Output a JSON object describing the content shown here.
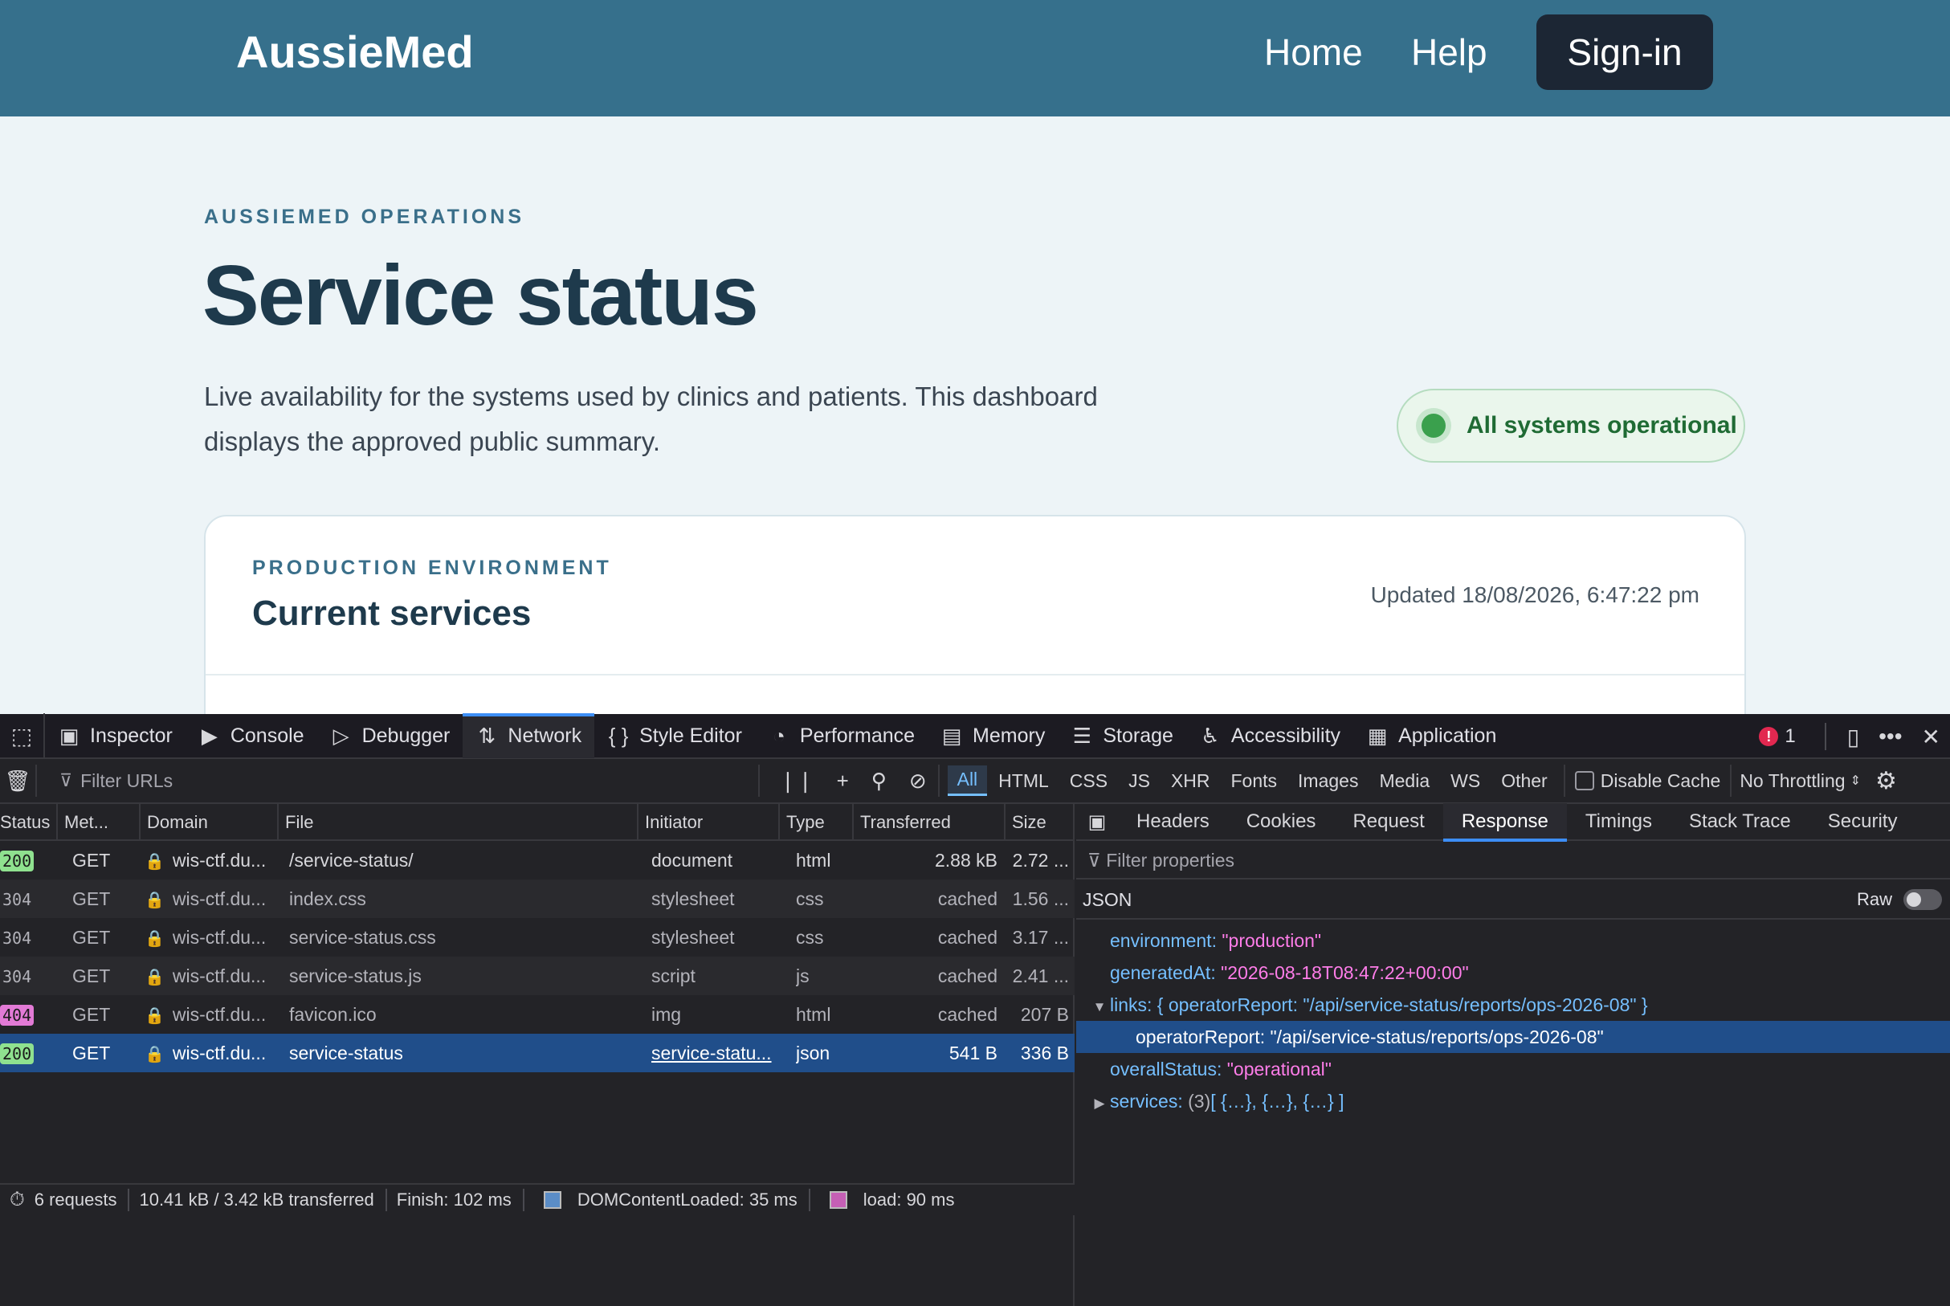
{
  "site": {
    "brand": "AussieMed",
    "nav": {
      "home": "Home",
      "help": "Help",
      "signin": "Sign-in"
    },
    "eyebrow": "AUSSIEMED OPERATIONS",
    "title": "Service status",
    "intro": "Live availability for the systems used by clinics and patients. This dashboard displays the approved public summary.",
    "status_pill": "All systems operational",
    "card": {
      "eyebrow": "PRODUCTION ENVIRONMENT",
      "title": "Current services",
      "updated": "Updated 18/08/2026, 6:47:22 pm"
    }
  },
  "devtools": {
    "tabs": [
      "Inspector",
      "Console",
      "Debugger",
      "Network",
      "Style Editor",
      "Performance",
      "Memory",
      "Storage",
      "Accessibility",
      "Application"
    ],
    "active_tab": "Network",
    "error_count": "1",
    "filter_placeholder": "Filter URLs",
    "type_filters": [
      "All",
      "HTML",
      "CSS",
      "JS",
      "XHR",
      "Fonts",
      "Images",
      "Media",
      "WS",
      "Other"
    ],
    "disable_cache": "Disable Cache",
    "throttling": "No Throttling",
    "columns": [
      "Status",
      "Met...",
      "Domain",
      "File",
      "Initiator",
      "Type",
      "Transferred",
      "Size"
    ],
    "requests": [
      {
        "status": "200",
        "method": "GET",
        "domain": "wis-ctf.du...",
        "file": "/service-status/",
        "initiator": "document",
        "type": "html",
        "transferred": "2.88 kB",
        "size": "2.72 ..."
      },
      {
        "status": "304",
        "method": "GET",
        "domain": "wis-ctf.du...",
        "file": "index.css",
        "initiator": "stylesheet",
        "type": "css",
        "transferred": "cached",
        "size": "1.56 ..."
      },
      {
        "status": "304",
        "method": "GET",
        "domain": "wis-ctf.du...",
        "file": "service-status.css",
        "initiator": "stylesheet",
        "type": "css",
        "transferred": "cached",
        "size": "3.17 ..."
      },
      {
        "status": "304",
        "method": "GET",
        "domain": "wis-ctf.du...",
        "file": "service-status.js",
        "initiator": "script",
        "type": "js",
        "transferred": "cached",
        "size": "2.41 ..."
      },
      {
        "status": "404",
        "method": "GET",
        "domain": "wis-ctf.du...",
        "file": "favicon.ico",
        "initiator": "img",
        "type": "html",
        "transferred": "cached",
        "size": "207 B"
      },
      {
        "status": "200",
        "method": "GET",
        "domain": "wis-ctf.du...",
        "file": "service-status",
        "initiator": "service-statu...",
        "type": "json",
        "transferred": "541 B",
        "size": "336 B"
      }
    ],
    "summary": {
      "requests": "6 requests",
      "transferred": "10.41 kB / 3.42 kB transferred",
      "finish": "Finish: 102 ms",
      "dcl": "DOMContentLoaded: 35 ms",
      "load": "load: 90 ms"
    },
    "detail_tabs": [
      "Headers",
      "Cookies",
      "Request",
      "Response",
      "Timings",
      "Stack Trace",
      "Security"
    ],
    "active_detail_tab": "Response",
    "filter_properties": "Filter properties",
    "json_label": "JSON",
    "raw_label": "Raw",
    "json": {
      "environment_key": "environment:",
      "environment_val": "\"production\"",
      "generated_key": "generatedAt:",
      "generated_val": "\"2026-08-18T08:47:22+00:00\"",
      "links_key": "links:",
      "links_val": "{ operatorReport: \"/api/service-status/reports/ops-2026-08\" }",
      "operator_key": "operatorReport:",
      "operator_val": "\"/api/service-status/reports/ops-2026-08\"",
      "overall_key": "overallStatus:",
      "overall_val": "\"operational\"",
      "services_key": "services:",
      "services_count": "(3)",
      "services_val": "[ {…}, {…}, {…} ]"
    }
  }
}
